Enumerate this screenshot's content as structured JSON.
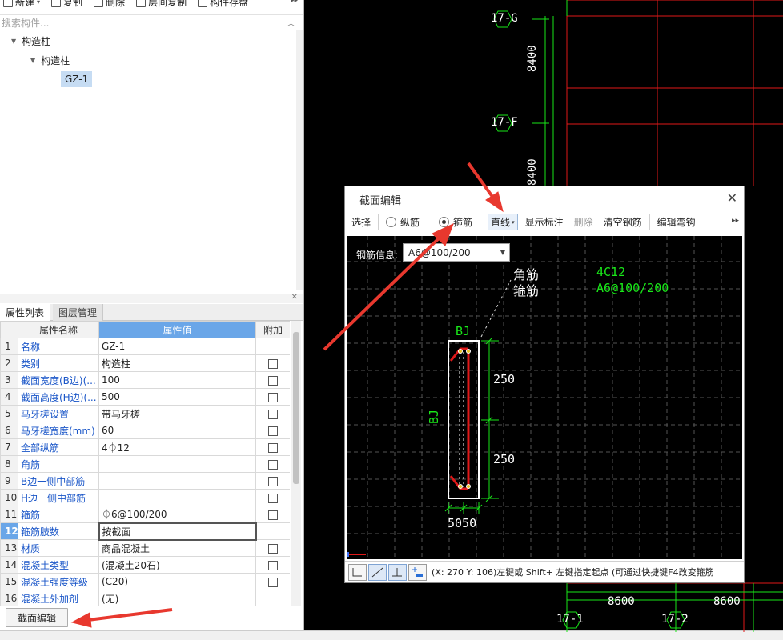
{
  "toolbar": {
    "new_label": "新建",
    "copy_label": "复制",
    "delete_label": "删除",
    "layer_copy_label": "层间复制",
    "save_label": "构件存盘"
  },
  "search": {
    "placeholder": "搜索构件..."
  },
  "tree": {
    "root": "构造柱",
    "child": "构造柱",
    "leaf": "GZ-1"
  },
  "tabs": {
    "props": "属性列表",
    "layers": "图层管理"
  },
  "prop_table": {
    "headers": {
      "name": "属性名称",
      "value": "属性值",
      "add": "附加"
    },
    "rows": [
      {
        "idx": "1",
        "name": "名称",
        "value": "GZ-1",
        "check": false
      },
      {
        "idx": "2",
        "name": "类别",
        "value": "构造柱",
        "check": true
      },
      {
        "idx": "3",
        "name": "截面宽度(B边)(...",
        "value": "100",
        "check": true
      },
      {
        "idx": "4",
        "name": "截面高度(H边)(...",
        "value": "500",
        "check": true
      },
      {
        "idx": "5",
        "name": "马牙槎设置",
        "value": "带马牙槎",
        "check": true
      },
      {
        "idx": "6",
        "name": "马牙槎宽度(mm)",
        "value": "60",
        "check": true
      },
      {
        "idx": "7",
        "name": "全部纵筋",
        "value": "4⏀12",
        "check": true
      },
      {
        "idx": "8",
        "name": "角筋",
        "value": "",
        "check": true
      },
      {
        "idx": "9",
        "name": "B边一侧中部筋",
        "value": "",
        "check": true
      },
      {
        "idx": "10",
        "name": "H边一侧中部筋",
        "value": "",
        "check": true
      },
      {
        "idx": "11",
        "name": "箍筋",
        "value": "⏀6@100/200",
        "check": true
      },
      {
        "idx": "12",
        "name": "箍筋肢数",
        "value": "按截面",
        "check": false,
        "selected": true
      },
      {
        "idx": "13",
        "name": "材质",
        "value": "商品混凝土",
        "check": true
      },
      {
        "idx": "14",
        "name": "混凝土类型",
        "value": "(混凝土20石)",
        "check": true
      },
      {
        "idx": "15",
        "name": "混凝土强度等级",
        "value": "(C20)",
        "check": true
      },
      {
        "idx": "16",
        "name": "混凝土外加剂",
        "value": "(无)",
        "check": false
      }
    ]
  },
  "section_edit_button": "截面编辑",
  "cad": {
    "axis_labels": [
      "17-G",
      "17-F",
      "17-1",
      "17-2"
    ],
    "dims": [
      "8400",
      "8400",
      "8600",
      "8600"
    ]
  },
  "dialog": {
    "title": "截面编辑",
    "toolbar": {
      "select": "选择",
      "longitudinal": "纵筋",
      "stirrup": "箍筋",
      "line": "直线",
      "show_label": "显示标注",
      "delete": "删除",
      "clear_rebar": "清空钢筋",
      "edit_hook": "编辑弯钩"
    },
    "rebar_info_label": "钢筋信息:",
    "rebar_info_value": "A6@100/200",
    "drawing": {
      "corner_label": "角筋",
      "stirrup_label": "箍筋",
      "corner_value": "4C12",
      "stirrup_value": "A6@100/200",
      "bj_top": "BJ",
      "bj_left": "BJ",
      "dim_top": "250",
      "dim_bottom": "250",
      "dim_width": "5050"
    },
    "status_text": "(X: 270 Y: 106)左键或 Shift+ 左键指定起点 (可通过快捷键F4改变箍筋"
  },
  "colors": {
    "accent": "#6aa6e8",
    "arrow": "#e8382e",
    "cad_green": "#19e619",
    "cad_red": "#e01919"
  }
}
